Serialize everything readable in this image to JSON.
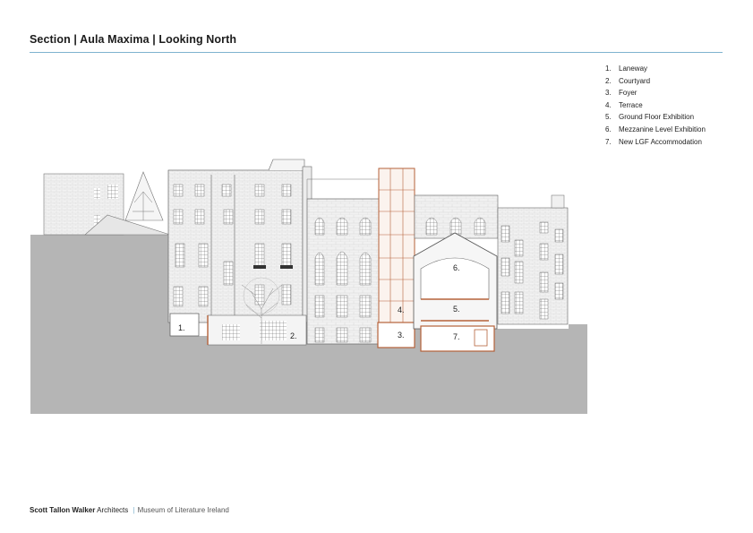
{
  "title": "Section | Aula Maxima | Looking North",
  "legend": [
    {
      "num": "1.",
      "label": "Laneway"
    },
    {
      "num": "2.",
      "label": "Courtyard"
    },
    {
      "num": "3.",
      "label": "Foyer"
    },
    {
      "num": "4.",
      "label": "Terrace"
    },
    {
      "num": "5.",
      "label": "Ground Floor Exhibition"
    },
    {
      "num": "6.",
      "label": "Mezzanine Level Exhibition"
    },
    {
      "num": "7.",
      "label": "New LGF Accommodation"
    }
  ],
  "drawing_labels": {
    "l1": "1.",
    "l2": "2.",
    "l3": "3.",
    "l4": "4.",
    "l5": "5.",
    "l6": "6.",
    "l7": "7."
  },
  "footer": {
    "firm": "Scott Tallon Walker",
    "firm_suffix": "Architects",
    "separator": "|",
    "project": "Museum of Literature Ireland"
  },
  "colors": {
    "accent_rule": "#7fb3cf",
    "ground": "#b5b5b5",
    "section_cut": "#b5623a",
    "line": "#666666"
  }
}
